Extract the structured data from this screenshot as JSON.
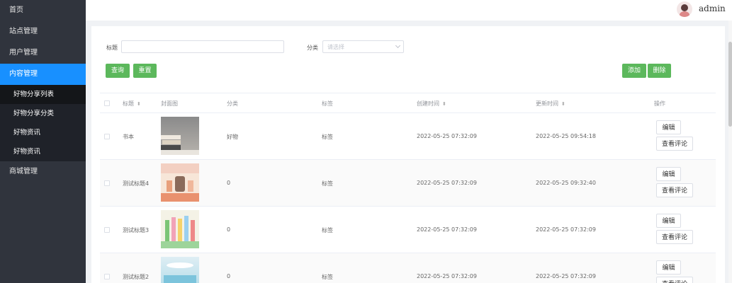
{
  "sidebar": {
    "items": [
      {
        "label": "首页"
      },
      {
        "label": "站点管理"
      },
      {
        "label": "用户管理"
      },
      {
        "label": "内容管理"
      },
      {
        "label": "商城管理"
      }
    ],
    "sub_items": [
      {
        "label": "好物分享列表"
      },
      {
        "label": "好物分享分类"
      },
      {
        "label": "好物资讯"
      },
      {
        "label": "好物资讯"
      }
    ]
  },
  "header": {
    "username": "admin"
  },
  "filter": {
    "title_label": "标题",
    "category_label": "分类",
    "category_placeholder": "请选择",
    "query_button": "查询",
    "reset_button": "重置",
    "add_button": "添加",
    "delete_button": "删除"
  },
  "table": {
    "columns": [
      "标题",
      "封面图",
      "分类",
      "标签",
      "创建时间",
      "更新时间",
      "操作"
    ],
    "rows": [
      {
        "title": "书本",
        "category": "好物",
        "tag": "标签",
        "created": "2022-05-25 07:32:09",
        "updated": "2022-05-25 09:54:18"
      },
      {
        "title": "测试标题4",
        "category": "0",
        "tag": "标签",
        "created": "2022-05-25 07:32:09",
        "updated": "2022-05-25 09:32:40"
      },
      {
        "title": "测试标题3",
        "category": "0",
        "tag": "标签",
        "created": "2022-05-25 07:32:09",
        "updated": "2022-05-25 07:32:09"
      },
      {
        "title": "测试标题2",
        "category": "0",
        "tag": "标签",
        "created": "2022-05-25 07:32:09",
        "updated": "2022-05-25 07:32:09"
      }
    ],
    "edit_label": "编辑",
    "comments_label": "查看评论"
  },
  "colors": {
    "sidebar_bg": "#30343d",
    "active": "#1890ff",
    "success": "#5cb85c"
  }
}
